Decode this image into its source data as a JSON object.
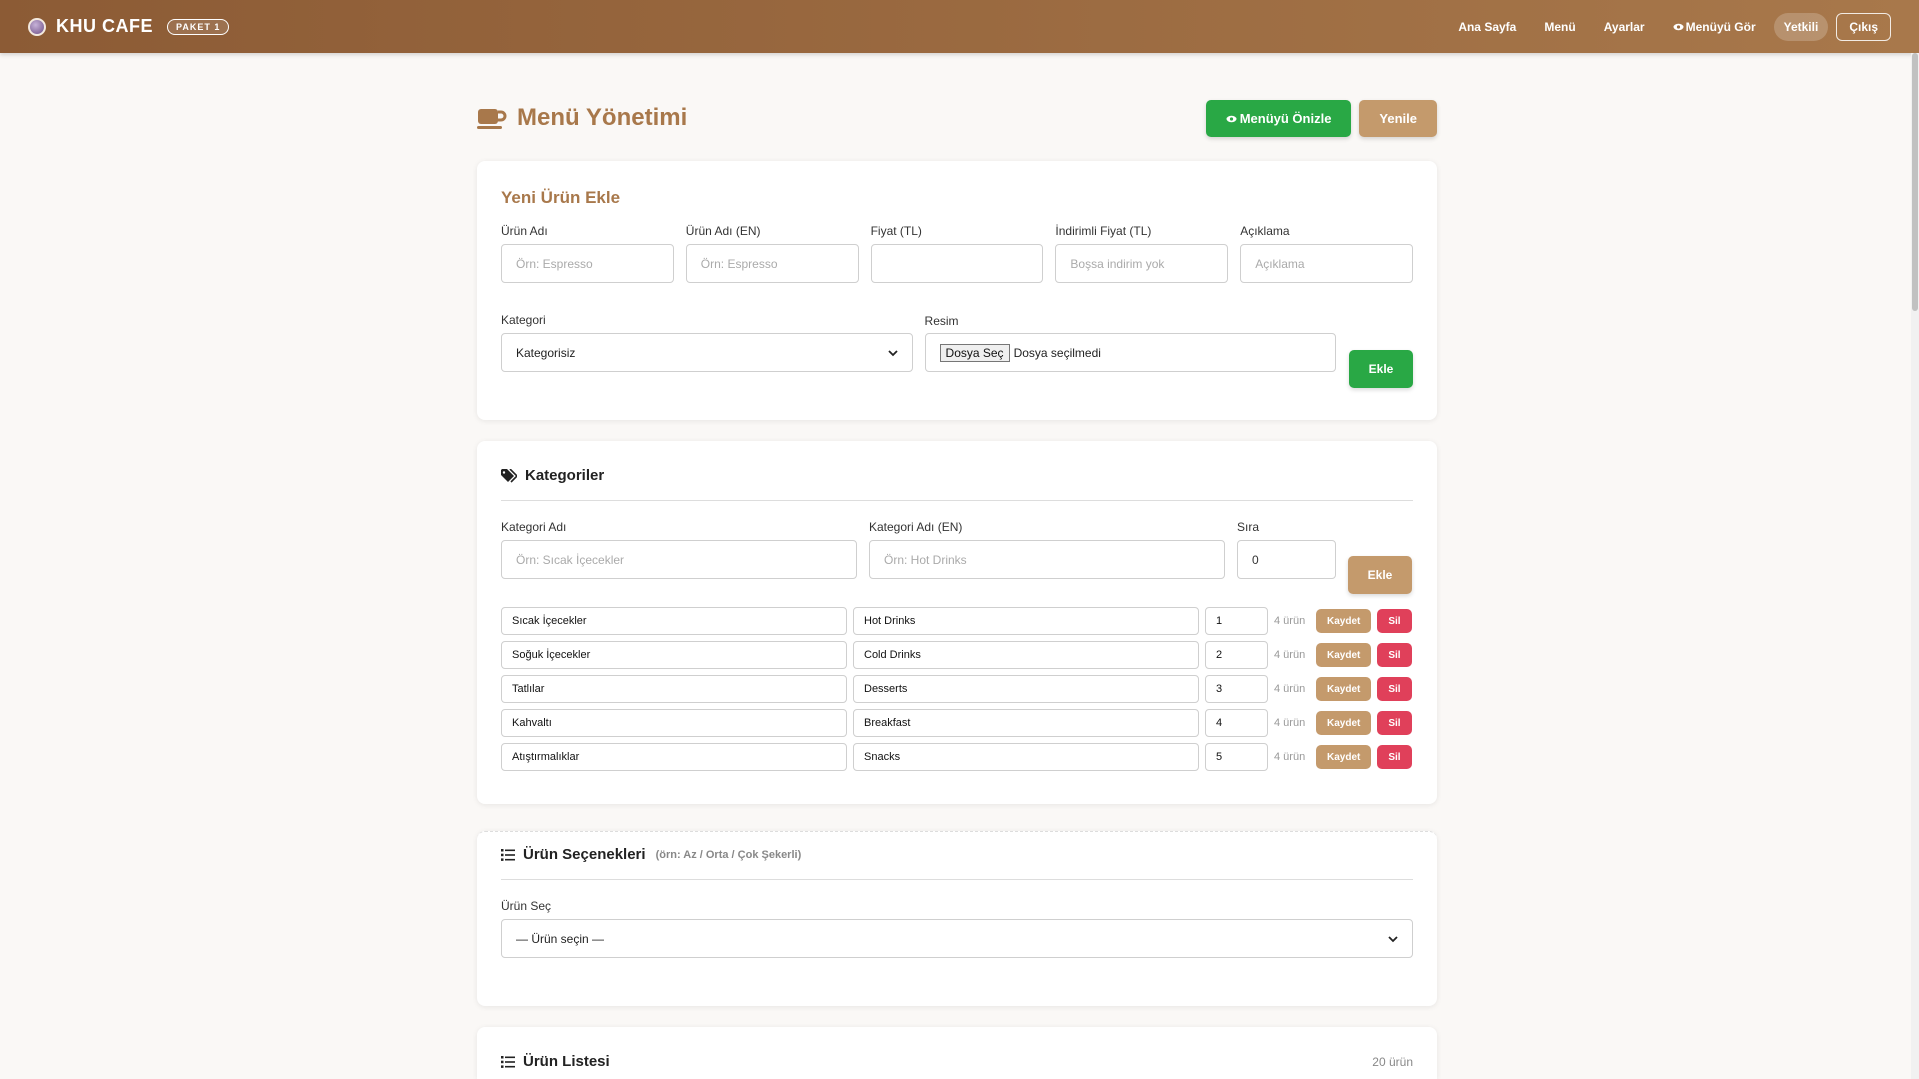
{
  "navbar": {
    "brand": "KHU CAFE",
    "badge": "PAKET 1",
    "links": {
      "home": "Ana Sayfa",
      "menu": "Menü",
      "settings": "Ayarlar",
      "view_menu": "Menüyü Gör",
      "role": "Yetkili",
      "logout": "Çıkış"
    }
  },
  "page": {
    "title": "Menü Yönetimi",
    "preview_button": "Menüyü Önizle",
    "refresh_button": "Yenile"
  },
  "add_product": {
    "title": "Yeni Ürün Ekle",
    "fields": {
      "name_label": "Ürün Adı",
      "name_placeholder": "Örn: Espresso",
      "name_en_label": "Ürün Adı (EN)",
      "name_en_placeholder": "Örn: Espresso",
      "price_label": "Fiyat (TL)",
      "discount_label": "İndirimli Fiyat (TL)",
      "discount_placeholder": "Boşsa indirim yok",
      "desc_label": "Açıklama",
      "desc_placeholder": "Açıklama",
      "category_label": "Kategori",
      "category_value": "Kategorisiz",
      "image_label": "Resim",
      "file_button": "Dosya Seç",
      "file_status": "Dosya seçilmedi"
    },
    "add_button": "Ekle"
  },
  "categories": {
    "title": "Kategoriler",
    "name_label": "Kategori Adı",
    "name_placeholder": "Örn: Sıcak İçecekler",
    "name_en_label": "Kategori Adı (EN)",
    "name_en_placeholder": "Örn: Hot Drinks",
    "order_label": "Sıra",
    "order_value": "0",
    "add_button": "Ekle",
    "save_label": "Kaydet",
    "delete_label": "Sil",
    "items": [
      {
        "name": "Sıcak İçecekler",
        "name_en": "Hot Drinks",
        "order": "1",
        "count": "4 ürün"
      },
      {
        "name": "Soğuk İçecekler",
        "name_en": "Cold Drinks",
        "order": "2",
        "count": "4 ürün"
      },
      {
        "name": "Tatlılar",
        "name_en": "Desserts",
        "order": "3",
        "count": "4 ürün"
      },
      {
        "name": "Kahvaltı",
        "name_en": "Breakfast",
        "order": "4",
        "count": "4 ürün"
      },
      {
        "name": "Atıştırmalıklar",
        "name_en": "Snacks",
        "order": "5",
        "count": "4 ürün"
      }
    ]
  },
  "options": {
    "title": "Ürün Seçenekleri",
    "hint": "(örn: Az / Orta / Çok Şekerli)",
    "product_label": "Ürün Seç",
    "product_value": "— Ürün seçin —"
  },
  "product_list": {
    "title": "Ürün Listesi",
    "count": "20 ürün"
  },
  "colors": {
    "navbar": "#8c5b35",
    "accent_brown": "#a8784b",
    "button_brown": "#c49a6c",
    "button_green": "#29a845",
    "button_red": "#e0405a"
  }
}
